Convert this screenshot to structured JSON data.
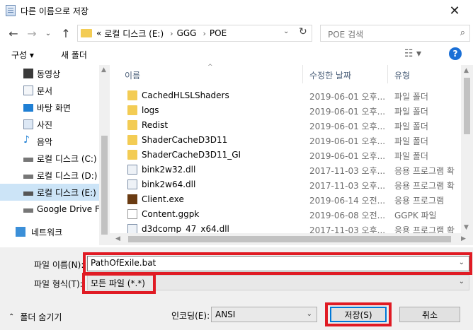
{
  "window": {
    "title": "다른 이름으로 저장",
    "close_glyph": "✕"
  },
  "address": {
    "overflow": "«",
    "crumbs": [
      "로컬 디스크 (E:)",
      "GGG",
      "POE"
    ],
    "search_placeholder": "POE 검색"
  },
  "toolbar": {
    "organize": "구성 ▾",
    "new_folder": "새 폴더"
  },
  "nav": {
    "items": [
      {
        "label": "동영상",
        "icon": "video-icon"
      },
      {
        "label": "문서",
        "icon": "document-icon"
      },
      {
        "label": "바탕 화면",
        "icon": "desktop-icon"
      },
      {
        "label": "사진",
        "icon": "picture-icon"
      },
      {
        "label": "음악",
        "icon": "music-icon"
      },
      {
        "label": "로컬 디스크 (C:)",
        "icon": "drive-icon"
      },
      {
        "label": "로컬 디스크 (D:)",
        "icon": "drive-icon"
      },
      {
        "label": "로컬 디스크 (E:)",
        "icon": "drive-icon"
      },
      {
        "label": "Google Drive File",
        "icon": "drive-icon"
      },
      {
        "label": "네트워크",
        "icon": "network-icon"
      }
    ]
  },
  "columns": {
    "name": "이름",
    "date": "수정한 날짜",
    "type": "유형"
  },
  "files": [
    {
      "name": "CachedHLSLShaders",
      "date": "2019-06-01 오후...",
      "type": "파일 폴더",
      "kind": "folder"
    },
    {
      "name": "logs",
      "date": "2019-06-01 오후...",
      "type": "파일 폴더",
      "kind": "folder"
    },
    {
      "name": "Redist",
      "date": "2019-06-01 오후...",
      "type": "파일 폴더",
      "kind": "folder"
    },
    {
      "name": "ShaderCacheD3D11",
      "date": "2019-06-01 오후...",
      "type": "파일 폴더",
      "kind": "folder"
    },
    {
      "name": "ShaderCacheD3D11_GI",
      "date": "2019-06-01 오후...",
      "type": "파일 폴더",
      "kind": "folder"
    },
    {
      "name": "bink2w32.dll",
      "date": "2017-11-03 오후...",
      "type": "응용 프로그램 확",
      "kind": "dll"
    },
    {
      "name": "bink2w64.dll",
      "date": "2017-11-03 오후...",
      "type": "응용 프로그램 확",
      "kind": "dll"
    },
    {
      "name": "Client.exe",
      "date": "2019-06-14 오전...",
      "type": "응용 프로그램",
      "kind": "exe"
    },
    {
      "name": "Content.ggpk",
      "date": "2019-06-08 오전...",
      "type": "GGPK 파일",
      "kind": "pak"
    },
    {
      "name": "d3dcomp_47_x64.dll",
      "date": "2017-11-03 오후...",
      "type": "응용 프로그램 확",
      "kind": "dll"
    }
  ],
  "form": {
    "filename_label": "파일 이름(N):",
    "filename_value": "PathOfExile.bat",
    "filetype_label": "파일 형식(T):",
    "filetype_value": "모든 파일 (*.*)",
    "hide_folders": "폴더 숨기기",
    "encoding_label": "인코딩(E):",
    "encoding_value": "ANSI",
    "save": "저장(S)",
    "cancel": "취소"
  },
  "colors": {
    "highlight": "#e01b24",
    "selected": "#cce4f7",
    "accent": "#0078d7"
  }
}
